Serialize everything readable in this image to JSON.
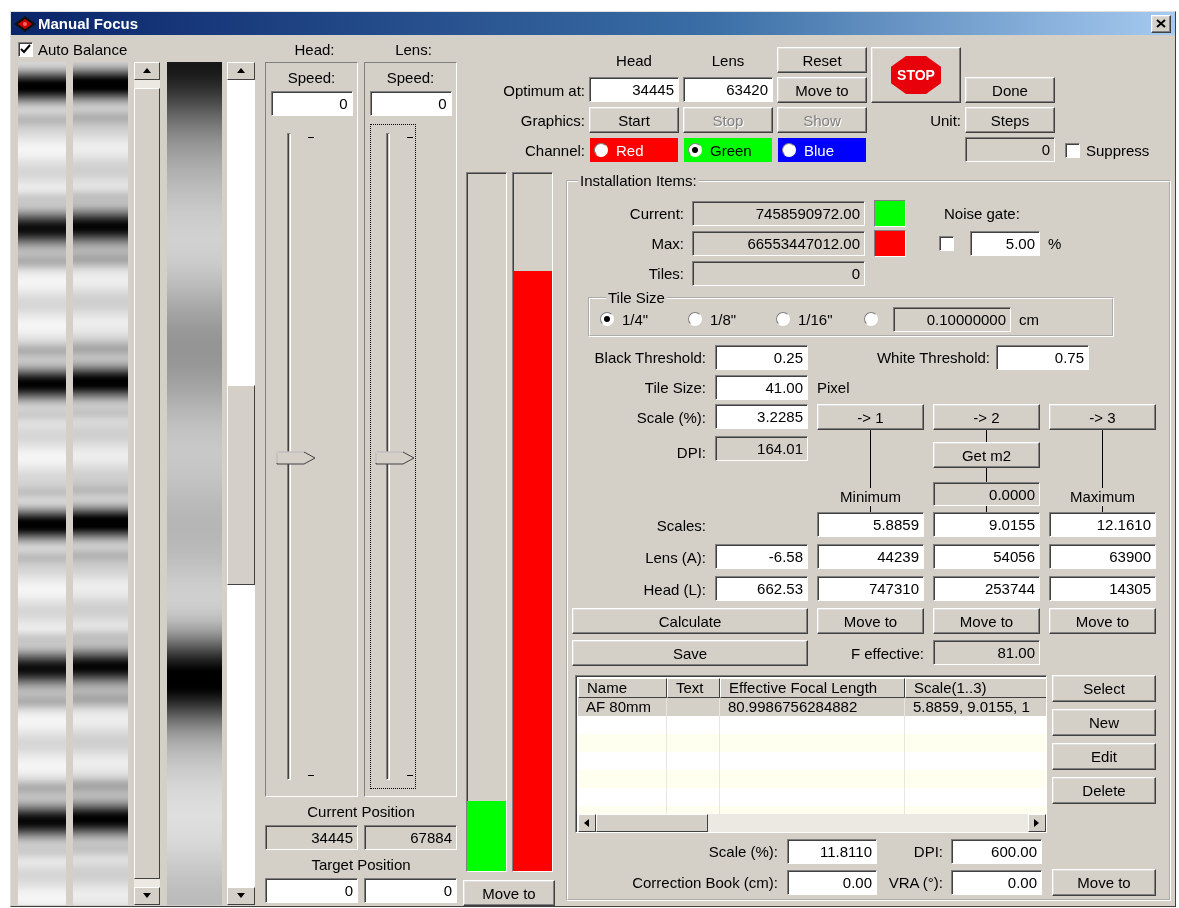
{
  "window": {
    "title": "Manual Focus"
  },
  "auto_balance": {
    "label": "Auto Balance",
    "checked": true
  },
  "axes": [
    {
      "label": "Head:",
      "speed_label": "Speed:",
      "speed": "0",
      "level": 0.5,
      "focused": false
    },
    {
      "label": "Lens:",
      "speed_label": "Speed:",
      "speed": "0",
      "level": 0.5,
      "focused": true
    }
  ],
  "current_position": {
    "label": "Current Position",
    "values": [
      "34445",
      "67884"
    ]
  },
  "target_position": {
    "label": "Target Position",
    "values": [
      "0",
      "0"
    ]
  },
  "meters": [
    {
      "color": "#00ff00",
      "level": 0.1
    },
    {
      "color": "#ff0000",
      "level": 0.86
    }
  ],
  "meter_move_button": "Move to",
  "optimum": {
    "columns": [
      "Head",
      "Lens"
    ],
    "label": "Optimum at:",
    "values": [
      "34445",
      "63420"
    ]
  },
  "reset_button": "Reset",
  "move_to_button": "Move to",
  "stop_button": "STOP",
  "done_button": "Done",
  "graphics": {
    "label": "Graphics:",
    "buttons": [
      {
        "label": "Start",
        "disabled": false
      },
      {
        "label": "Stop",
        "disabled": true
      },
      {
        "label": "Show",
        "disabled": true
      }
    ]
  },
  "channel": {
    "label": "Channel:",
    "options": [
      {
        "label": "Red",
        "color": "#ff0000",
        "selected": false
      },
      {
        "label": "Green",
        "color": "#00ff00",
        "selected": true
      },
      {
        "label": "Blue",
        "color": "#0000ff",
        "selected": false
      }
    ]
  },
  "unit": {
    "label": "Unit:",
    "button": "Steps",
    "value": "0"
  },
  "suppress": {
    "label": "Suppress",
    "checked": false
  },
  "installation": {
    "title": "Installation Items:",
    "readings": [
      {
        "label": "Current:",
        "value": "7458590972.00",
        "color": "#00ff00"
      },
      {
        "label": "Max:",
        "value": "66553447012.00",
        "color": "#ff0000"
      },
      {
        "label": "Tiles:",
        "value": "0"
      }
    ],
    "noise_gate": {
      "label": "Noise gate:",
      "checked": false,
      "value": "5.00",
      "unit": "%"
    },
    "tile_size_group": {
      "title": "Tile Size",
      "options": [
        {
          "label": "1/4\"",
          "selected": true
        },
        {
          "label": "1/8\"",
          "selected": false
        },
        {
          "label": "1/16\"",
          "selected": false
        },
        {
          "selected": false,
          "value": "0.10000000",
          "unit": "cm"
        }
      ]
    },
    "black_threshold": {
      "label": "Black Threshold:",
      "value": "0.25"
    },
    "white_threshold": {
      "label": "White Threshold:",
      "value": "0.75"
    },
    "tile_size": {
      "label": "Tile Size:",
      "value": "41.00",
      "unit": "Pixel"
    },
    "scale": {
      "label": "Scale (%):",
      "value": "3.2285"
    },
    "dpi": {
      "label": "DPI:",
      "value": "164.01"
    },
    "slot_buttons": [
      "-> 1",
      "-> 2",
      "-> 3"
    ],
    "get_m2_button": "Get m2",
    "m2_value": "0.0000",
    "slot_labels": [
      "Minimum",
      "Maximum"
    ],
    "scales": {
      "label": "Scales:",
      "values": [
        "5.8859",
        "9.0155",
        "12.1610"
      ]
    },
    "lens": {
      "label": "Lens (A):",
      "value": "-6.58",
      "values": [
        "44239",
        "54056",
        "63900"
      ]
    },
    "head": {
      "label": "Head (L):",
      "value": "662.53",
      "values": [
        "747310",
        "253744",
        "14305"
      ]
    },
    "calculate_button": "Calculate",
    "slot_move_buttons": [
      "Move to",
      "Move to",
      "Move to"
    ],
    "save_button": "Save",
    "f_effective": {
      "label": "F effective:",
      "value": "81.00"
    },
    "table": {
      "columns": [
        "Name",
        "Text",
        "Effective Focal Length",
        "Scale(1..3)"
      ],
      "rows": [
        {
          "cells": [
            "AF 80mm",
            null,
            "80.9986756284882",
            "5.8859, 9.0155, 1"
          ],
          "selected": true
        }
      ]
    },
    "list_buttons": [
      "Select",
      "New",
      "Edit",
      "Delete"
    ],
    "book_scale": {
      "label": "Scale (%):",
      "value": "11.8110"
    },
    "book_dpi": {
      "label": "DPI:",
      "value": "600.00"
    },
    "correction_book": {
      "label": "Correction Book (cm):",
      "value": "0.00"
    },
    "vra": {
      "label": "VRA (°):",
      "value": "0.00"
    },
    "book_move_button": "Move to"
  }
}
